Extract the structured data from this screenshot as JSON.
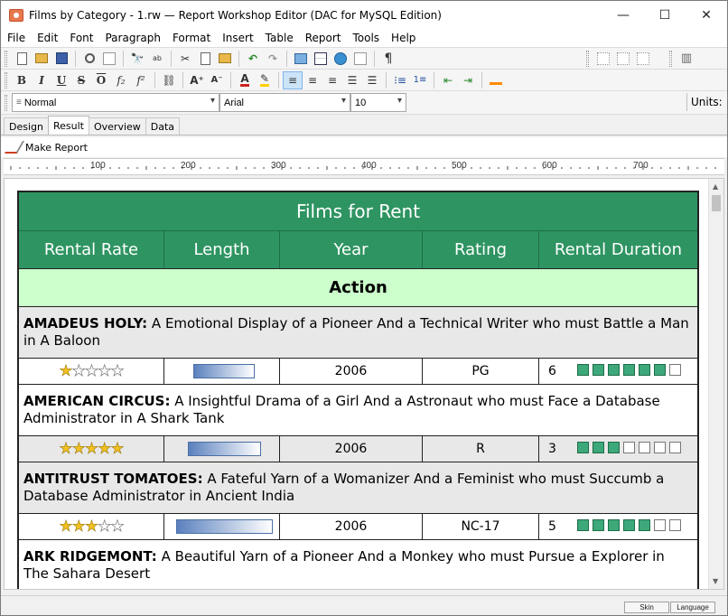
{
  "window": {
    "title": "Films by Category - 1.rw — Report Workshop Editor (DAC for MySQL Edition)",
    "min": "—",
    "max": "☐",
    "close": "✕"
  },
  "menu": [
    "File",
    "Edit",
    "Font",
    "Paragraph",
    "Format",
    "Insert",
    "Table",
    "Report",
    "Tools",
    "Help"
  ],
  "format_bar": {
    "style": "Normal",
    "font": "Arial",
    "size": "10",
    "units_label": "Units:"
  },
  "tabs": [
    "Design",
    "Result",
    "Overview",
    "Data"
  ],
  "active_tab": "Result",
  "make_report_label": "Make Report",
  "ruler_labels": [
    "100",
    "200",
    "300",
    "400",
    "500",
    "600",
    "700"
  ],
  "report": {
    "title": "Films for Rent",
    "headers": [
      "Rental Rate",
      "Length",
      "Year",
      "Rating",
      "Rental Duration"
    ],
    "category": "Action",
    "films": [
      {
        "name": "AMADEUS HOLY:",
        "description": " A Emotional Display of a Pioneer And a Technical Writer who must Battle a Man in A Baloon",
        "rate_stars": 1,
        "length_fraction": 0.52,
        "year": "2006",
        "rating": "PG",
        "duration": "6"
      },
      {
        "name": "AMERICAN CIRCUS:",
        "description": " A Insightful Drama of a Girl And a Astronaut who must Face a Database Administrator in A Shark Tank",
        "rate_stars": 5,
        "length_fraction": 0.62,
        "year": "2006",
        "rating": "R",
        "duration": "3"
      },
      {
        "name": "ANTITRUST TOMATOES:",
        "description": " A Fateful Yarn of a Womanizer And a Feminist who must Succumb a Database Administrator in Ancient India",
        "rate_stars": 3,
        "length_fraction": 0.82,
        "year": "2006",
        "rating": "NC-17",
        "duration": "5"
      },
      {
        "name": "ARK RIDGEMONT:",
        "description": " A Beautiful Yarn of a Pioneer And a Monkey who must Pursue a Explorer in The Sahara Desert"
      }
    ]
  },
  "status": {
    "skin": "Skin",
    "language": "Language"
  },
  "colors": {
    "header_green": "#2e9462",
    "category_bg": "#ccffcc",
    "star": "#f0c020",
    "duration_on": "#3da87a"
  }
}
